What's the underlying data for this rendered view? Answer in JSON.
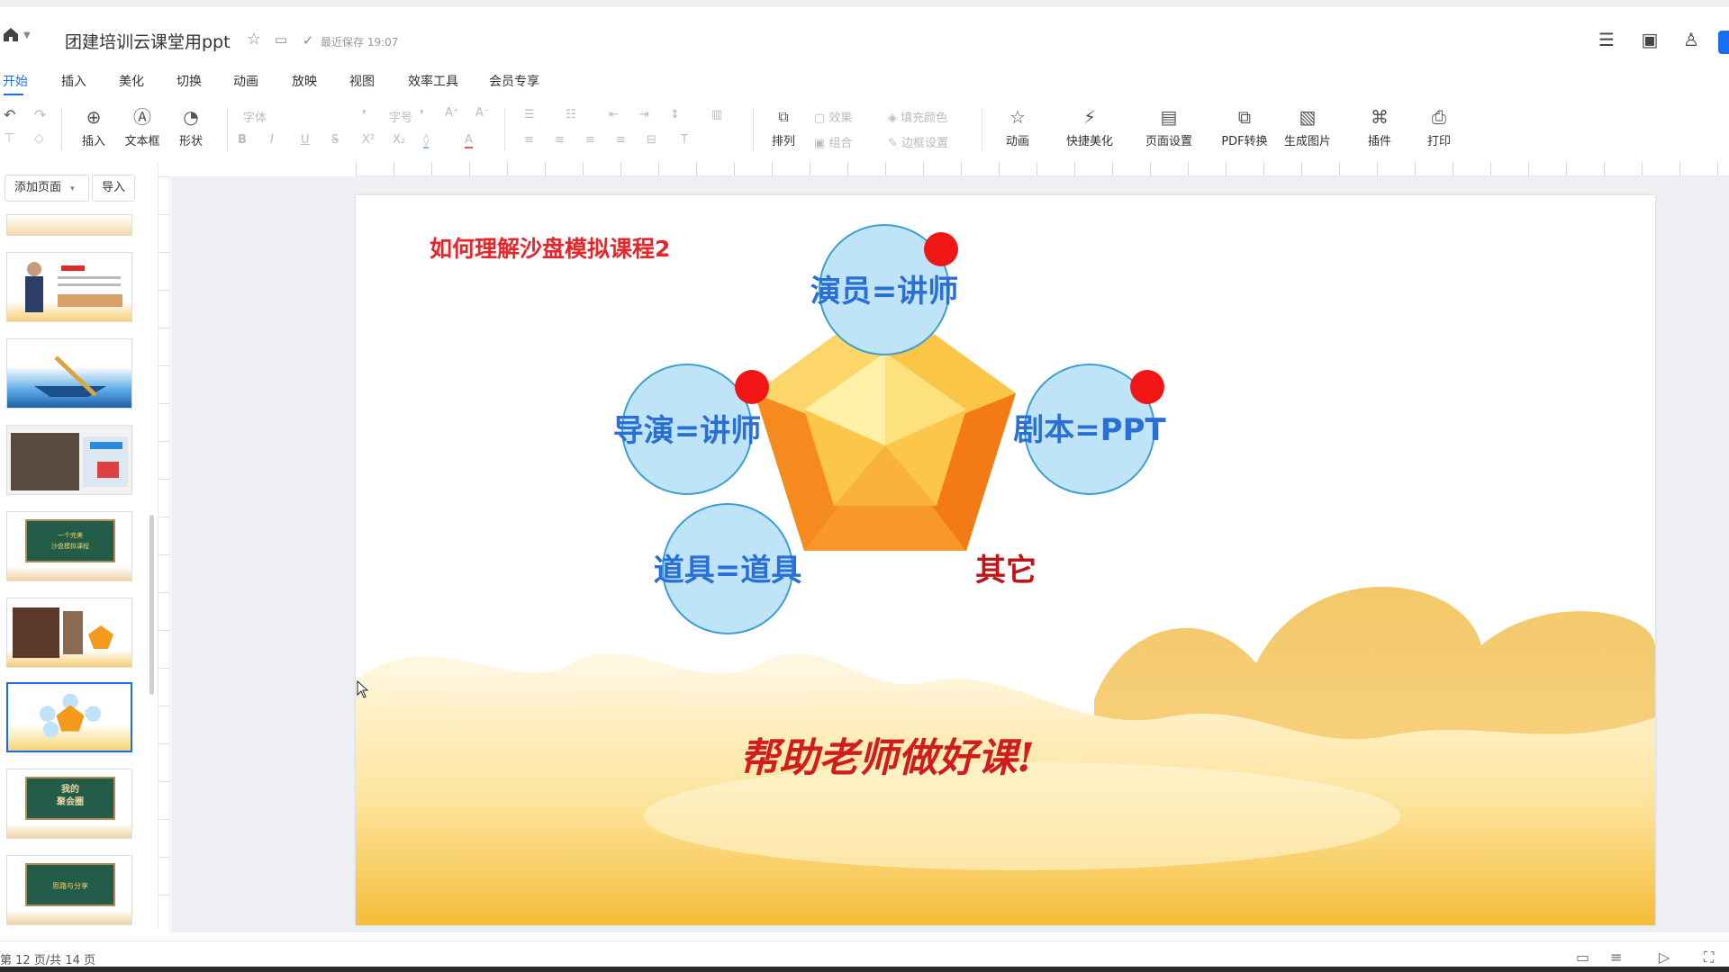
{
  "titlebar": {
    "doc_title": "团建培训云课堂用ppt",
    "save_status": "最近保存 19:07"
  },
  "tabs": [
    "开始",
    "插入",
    "美化",
    "切换",
    "动画",
    "放映",
    "视图",
    "效率工具",
    "会员专享"
  ],
  "ribbon": {
    "insert": "插入",
    "textbox": "文本框",
    "shape": "形状",
    "font": "字体",
    "font_size": "字号",
    "arrange": "排列",
    "effect": "效果",
    "group": "组合",
    "fill_color": "填充颜色",
    "border_settings": "边框设置",
    "animation": "动画",
    "quick_beautify": "快捷美化",
    "page_setup": "页面设置",
    "pdf_convert": "PDF转换",
    "make_image": "生成图片",
    "plugins": "插件",
    "print": "打印"
  },
  "left_panel": {
    "add_page": "添加页面",
    "import": "导入",
    "thumb_texts": {
      "t5": "一个完美\n沙盘模拟课程",
      "t8": "我的\n聚会圈",
      "t9": "思路与分享"
    }
  },
  "slide": {
    "title": "如何理解沙盘模拟课程2",
    "circle_top": "演员=讲师",
    "circle_left": "导演=讲师",
    "circle_right": "剧本=PPT",
    "circle_bottom": "道具=道具",
    "other": "其它",
    "slogan": "帮助老师做好课!"
  },
  "statusbar": {
    "page_info": "第 12 页/共 14 页"
  },
  "colors": {
    "accent": "#1a6cf3",
    "circle_fill": "#bfe3f7",
    "circle_text": "#2a6fd6",
    "title_red": "#e8262a",
    "dot_red": "#f01616"
  }
}
